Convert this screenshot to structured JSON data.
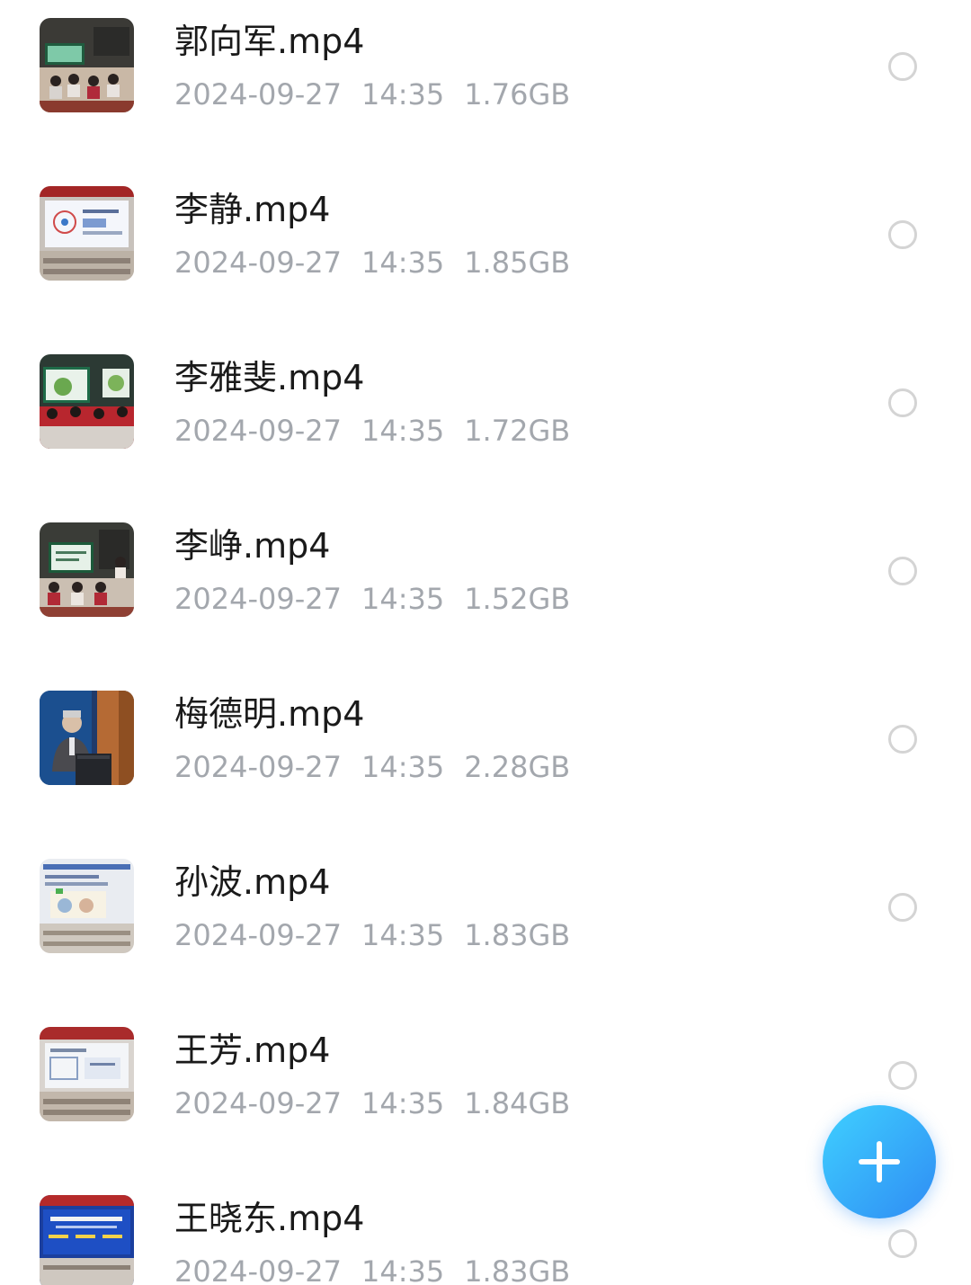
{
  "files": [
    {
      "name": "郭向军.mp4",
      "date": "2024-09-27",
      "time": "14:35",
      "size": "1.76GB",
      "thumbnail": "classroom-students-icon"
    },
    {
      "name": "李静.mp4",
      "date": "2024-09-27",
      "time": "14:35",
      "size": "1.85GB",
      "thumbnail": "presentation-screen-icon"
    },
    {
      "name": "李雅斐.mp4",
      "date": "2024-09-27",
      "time": "14:35",
      "size": "1.72GB",
      "thumbnail": "classroom-students-icon"
    },
    {
      "name": "李峥.mp4",
      "date": "2024-09-27",
      "time": "14:35",
      "size": "1.52GB",
      "thumbnail": "classroom-students-icon"
    },
    {
      "name": "梅德明.mp4",
      "date": "2024-09-27",
      "time": "14:35",
      "size": "2.28GB",
      "thumbnail": "speaker-at-podium-icon"
    },
    {
      "name": "孙波.mp4",
      "date": "2024-09-27",
      "time": "14:35",
      "size": "1.83GB",
      "thumbnail": "presentation-screen-icon"
    },
    {
      "name": "王芳.mp4",
      "date": "2024-09-27",
      "time": "14:35",
      "size": "1.84GB",
      "thumbnail": "presentation-screen-icon"
    },
    {
      "name": "王晓东.mp4",
      "date": "2024-09-27",
      "time": "14:35",
      "size": "1.83GB",
      "thumbnail": "conference-banner-icon"
    }
  ],
  "fab": {
    "icon": "plus-icon"
  },
  "colors": {
    "name_text": "#1a1a1a",
    "meta_text": "#a3a7ad",
    "radio_border": "#d4d4d4",
    "fab_start": "#3fd0ff",
    "fab_end": "#2f8cf4"
  }
}
